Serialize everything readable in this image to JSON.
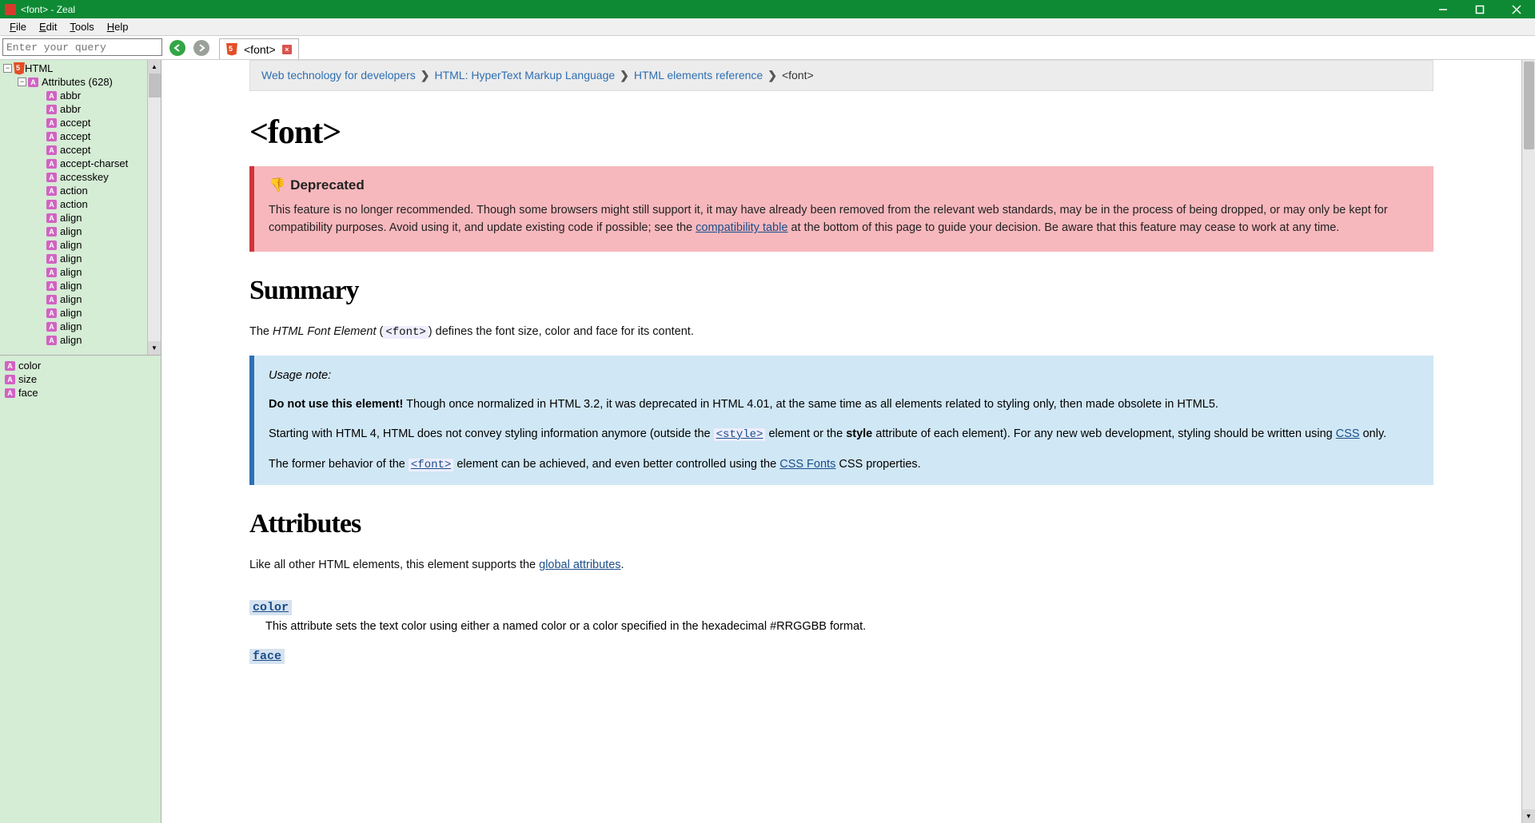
{
  "window": {
    "title": "<font> - Zeal"
  },
  "menu": {
    "file": "File",
    "edit": "Edit",
    "tools": "Tools",
    "help": "Help"
  },
  "search": {
    "placeholder": "Enter your query"
  },
  "tab": {
    "label": "<font>"
  },
  "tree": {
    "root": "HTML",
    "attributes_label": "Attributes (628)",
    "items": [
      "abbr",
      "abbr",
      "accept",
      "accept",
      "accept",
      "accept-charset",
      "accesskey",
      "action",
      "action",
      "align",
      "align",
      "align",
      "align",
      "align",
      "align",
      "align",
      "align",
      "align",
      "align"
    ]
  },
  "local_attrs": [
    "color",
    "size",
    "face"
  ],
  "breadcrumbs": {
    "a": "Web technology for developers",
    "b": "HTML: HyperText Markup Language",
    "c": "HTML elements reference",
    "d": "<font>"
  },
  "page_title": "<font>",
  "deprecated": {
    "heading": "Deprecated",
    "body_a": "This feature is no longer recommended. Though some browsers might still support it, it may have already been removed from the relevant web standards, may be in the process of being dropped, or may only be kept for compatibility purposes. Avoid using it, and update existing code if possible; see the ",
    "link": "compatibility table",
    "body_b": " at the bottom of this page to guide your decision. Be aware that this feature may cease to work at any time."
  },
  "summary": {
    "heading": "Summary",
    "p1_a": "The ",
    "p1_em": "HTML Font Element",
    "p1_b": " (",
    "p1_code": "<font>",
    "p1_c": ") defines the font size, color and face for its content."
  },
  "note": {
    "usage": "Usage note:",
    "p1_strong": "Do not use this element!",
    "p1_rest": " Though once normalized in HTML 3.2, it was deprecated in HTML 4.01, at the same time as all elements related to styling only, then made obsolete in HTML5.",
    "p2_a": "Starting with HTML 4, HTML does not convey styling information anymore (outside the ",
    "p2_code": "<style>",
    "p2_b": " element or the ",
    "p2_strong": "style",
    "p2_c": " attribute of each element). For any new web development, styling should be written using ",
    "p2_link": "CSS",
    "p2_d": " only.",
    "p3_a": "The former behavior of the ",
    "p3_code": "<font>",
    "p3_b": " element can be achieved, and even better controlled using the ",
    "p3_link": "CSS Fonts",
    "p3_c": " CSS properties."
  },
  "attributes": {
    "heading": "Attributes",
    "intro_a": "Like all other HTML elements, this element supports the ",
    "intro_link": "global attributes",
    "intro_b": ".",
    "color": {
      "name": "color",
      "desc": "This attribute sets the text color using either a named color or a color specified in the hexadecimal #RRGGBB format."
    },
    "face": {
      "name": "face"
    }
  }
}
